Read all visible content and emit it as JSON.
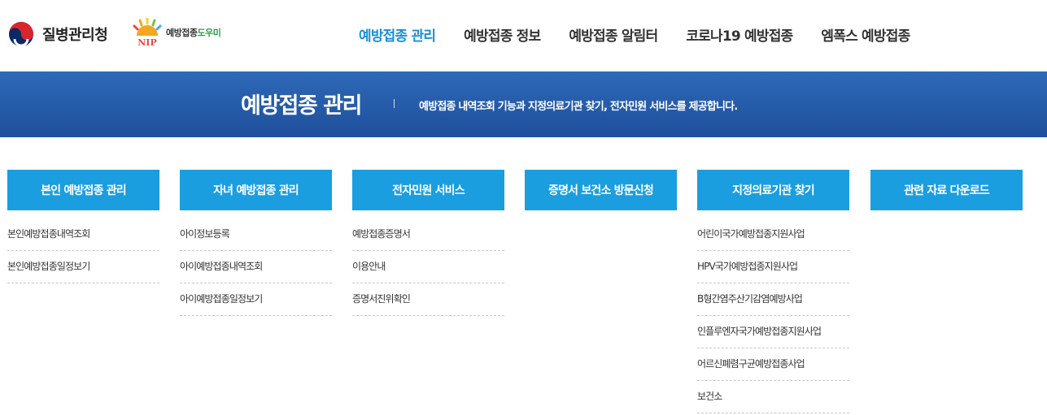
{
  "header": {
    "kdca_logo_text": "질병관리청",
    "nip_logo_text_main": "예방접종",
    "nip_logo_text_accent": "도우미",
    "nip_mark_text": "NIP",
    "nav": [
      {
        "label": "예방접종 관리",
        "active": true
      },
      {
        "label": "예방접종 정보",
        "active": false
      },
      {
        "label": "예방접종 알림터",
        "active": false
      },
      {
        "label": "코로나19 예방접종",
        "active": false
      },
      {
        "label": "엠폭스 예방접종",
        "active": false
      }
    ]
  },
  "banner": {
    "title": "예방접종 관리",
    "description": "예방접종 내역조회 기능과 지정의료기관 찾기, 전자민원 서비스를 제공합니다."
  },
  "menu": [
    {
      "title": "본인 예방접종 관리",
      "items": [
        "본인예방접종내역조회",
        "본인예방접종일정보기"
      ]
    },
    {
      "title": "자녀 예방접종 관리",
      "items": [
        "아이정보등록",
        "아이예방접종내역조회",
        "아이예방접종일정보기"
      ]
    },
    {
      "title": "전자민원 서비스",
      "items": [
        "예방접종증명서",
        "이용안내",
        "증명서진위확인"
      ]
    },
    {
      "title": "증명서 보건소 방문신청",
      "items": []
    },
    {
      "title": "지정의료기관 찾기",
      "items": [
        "어린이국가예방접종지원사업",
        "HPV국가예방접종지원사업",
        "B형간염주산기감염예방사업",
        "인플루엔자국가예방접종지원사업",
        "어르신폐렴구균예방접종사업",
        "보건소"
      ]
    },
    {
      "title": "관련 자료 다운로드",
      "items": []
    }
  ],
  "colors": {
    "accent": "#1a9ee0",
    "nav_active": "#1a8fd4",
    "banner_top": "#2e69b7",
    "banner_bottom": "#1e4f9c"
  }
}
